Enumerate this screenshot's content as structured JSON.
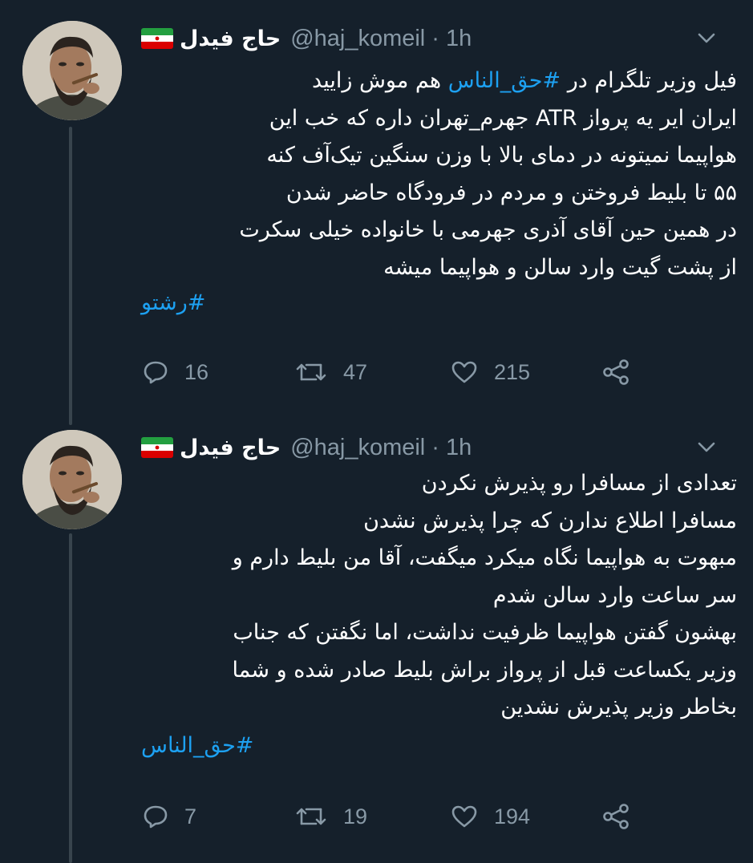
{
  "colors": {
    "background": "#15202b",
    "text": "#ffffff",
    "muted": "#8899a6",
    "link": "#1da1f2",
    "thread": "#38444d"
  },
  "tweets": [
    {
      "author_name": "حاج فیدل",
      "handle": "@haj_komeil",
      "time": "1h",
      "handle_time": "@haj_komeil · 1h",
      "lines": [
        "فیل وزیر تلگرام در #حق_الناس هم موش زایید",
        "ایران ایر یه پرواز ATR جهرم_تهران داره که خب این",
        "هواپیما نمیتونه در دمای بالا با وزن سنگین تیک‌آف کنه",
        "۵۵ تا بلیط فروختن و مردم در فرودگاه حاضر شدن",
        "در همین حین آقای آذری جهرمی با خانواده خیلی سکرت",
        "از پشت گیت وارد سالن و هواپیما میشه"
      ],
      "line1_pre": "فیل وزیر تلگرام در ",
      "line1_tag": "#حق_الناس",
      "line1_post": " هم موش زایید",
      "hashtag": "#رشتو",
      "replies": "16",
      "retweets": "47",
      "likes": "215"
    },
    {
      "author_name": "حاج فیدل",
      "handle": "@haj_komeil",
      "time": "1h",
      "handle_time": "@haj_komeil · 1h",
      "lines": [
        "تعدادی از مسافرا رو پذیرش نکردن",
        "مسافرا اطلاع ندارن که چرا پذیرش نشدن",
        "مبهوت به هواپیما نگاه میکرد میگفت، آقا من بلیط دارم و",
        "سر ساعت وارد سالن شدم",
        "بهشون گفتن هواپیما ظرفیت نداشت، اما نگفتن که جناب",
        "وزیر یکساعت قبل از پرواز براش بلیط صادر شده و شما",
        "بخاطر وزیر پذیرش نشدین"
      ],
      "hashtag": "#حق_الناس",
      "replies": "7",
      "retweets": "19",
      "likes": "194"
    }
  ]
}
